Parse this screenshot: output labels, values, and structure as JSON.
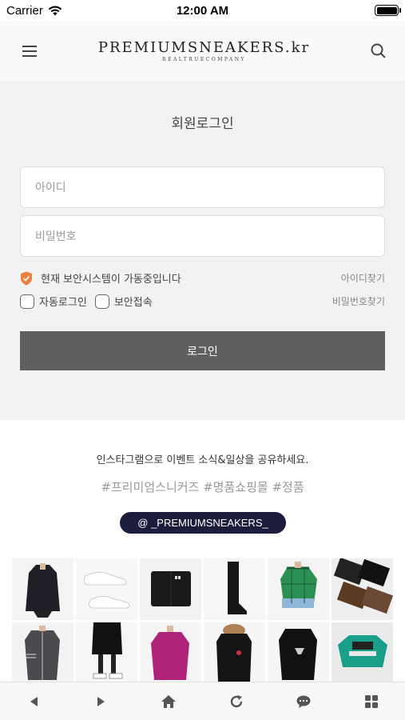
{
  "status": {
    "carrier": "Carrier",
    "time": "12:00 AM",
    "battery_level": 1.0
  },
  "header": {
    "logo_main": "PREMIUMSNEAKERS.kr",
    "logo_sub": "REALTRUECOMPANY",
    "menu_icon": "hamburger-icon",
    "search_icon": "search-icon"
  },
  "login": {
    "title": "회원로그인",
    "id_placeholder": "아이디",
    "password_placeholder": "비밀번호",
    "security_text": "현재 보안시스템이 가동중입니다",
    "find_id": "아이디찾기",
    "find_password": "비밀번호찾기",
    "auto_login": "자동로그인",
    "secure_access": "보안접속",
    "login_button": "로그인"
  },
  "instagram": {
    "intro": "인스타그램으로 이벤트 소식&일상을 공유하세요.",
    "hashtags": "#프리미엄스니커즈 #명품쇼핑몰 #정품",
    "handle": "@ _PREMIUMSNEAKERS_"
  },
  "grid_items": [
    "black-padded-coat",
    "white-sneakers",
    "black-wallet",
    "black-boots",
    "green-plaid-shirt",
    "wallet-colors",
    "gray-cardigan",
    "black-skirt-sneakers",
    "pink-hoodie",
    "black-parka-fur",
    "black-graphic-hoodie",
    "teal-paris-tee"
  ],
  "bottom_nav": [
    "back-arrow-icon",
    "forward-arrow-icon",
    "home-icon",
    "refresh-icon",
    "chat-icon",
    "grid-icon"
  ],
  "colors": {
    "accent_orange": "#ef7f3a",
    "handle_bg": "#1c1c3c",
    "button_bg": "#5f5f5f"
  }
}
